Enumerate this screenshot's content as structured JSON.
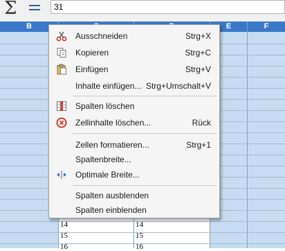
{
  "formula_bar": {
    "sigma": "Σ",
    "value": "31"
  },
  "columns": [
    "B",
    "C",
    "D",
    "E",
    "F"
  ],
  "cells": [
    {
      "text": "14"
    },
    {
      "text": "14"
    },
    {
      "text": "15"
    },
    {
      "text": "15"
    },
    {
      "text": "16"
    },
    {
      "text": "16"
    }
  ],
  "menu": {
    "items": [
      {
        "label": "Ausschneiden",
        "shortcut": "Strg+X",
        "icon": "scissors-icon"
      },
      {
        "label": "Kopieren",
        "shortcut": "Strg+C",
        "icon": "copy-icon"
      },
      {
        "label": "Einfügen",
        "shortcut": "Strg+V",
        "icon": "paste-icon"
      },
      {
        "label": "Inhalte einfügen...",
        "shortcut": "Strg+Umschalt+V",
        "icon": ""
      },
      {
        "label": "Spalten löschen",
        "shortcut": "",
        "icon": "delete-columns-icon"
      },
      {
        "label": "Zellinhalte löschen...",
        "shortcut": "Rück",
        "icon": "clear-contents-icon"
      },
      {
        "label": "Zellen formatieren...",
        "shortcut": "Strg+1",
        "icon": ""
      },
      {
        "label": "Spaltenbreite...",
        "shortcut": "",
        "icon": ""
      },
      {
        "label": "Optimale Breite...",
        "shortcut": "",
        "icon": "optimal-width-icon"
      },
      {
        "label": "Spalten ausblenden",
        "shortcut": "",
        "icon": ""
      },
      {
        "label": "Spalten einblenden",
        "shortcut": "",
        "icon": ""
      }
    ]
  },
  "colors": {
    "header_bg": "#3c78c8",
    "selection_bg": "#c6dcf2",
    "menu_bg": "#f5f5f5"
  }
}
